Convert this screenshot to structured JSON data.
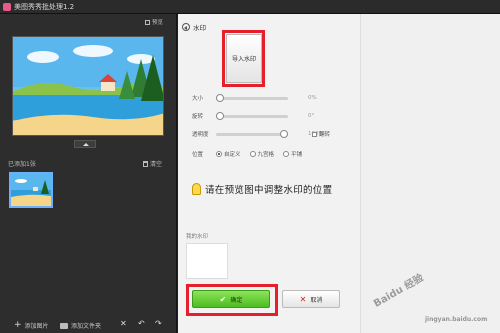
{
  "window": {
    "title": "美图秀秀批处理1.2"
  },
  "left_panel": {
    "preview_label": "预览",
    "added_count_label": "已添加1张",
    "clear_label": "清空",
    "bottom": {
      "add_image_label": "添加图片",
      "add_folder_label": "添加文件夹"
    }
  },
  "watermark_panel": {
    "back_label": "水印",
    "import_button_label": "导入水印",
    "sliders": [
      {
        "label": "大小",
        "value": "0%"
      },
      {
        "label": "旋转",
        "value": "0°"
      },
      {
        "label": "透明度",
        "value": "100%"
      }
    ],
    "flip_label": "翻转",
    "position_label": "位置",
    "position_options": [
      "自定义",
      "九宫格",
      "平铺"
    ],
    "position_selected": "自定义",
    "hint_text": "请在预览图中调整水印的位置",
    "my_watermark_label": "我的水印",
    "ok_label": "确定",
    "cancel_label": "取消"
  },
  "page_watermark": {
    "logo_text": "Baidu 经验",
    "url_text": "jingyan.baidu.com"
  }
}
